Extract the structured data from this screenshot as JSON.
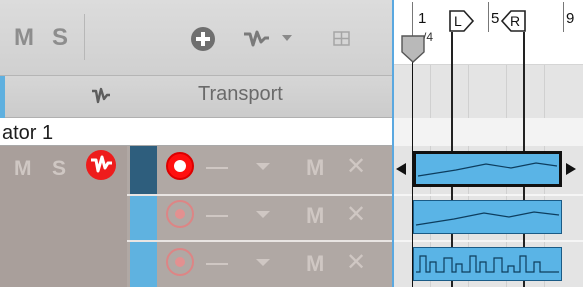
{
  "toolbar": {
    "mute_label": "M",
    "solo_label": "S",
    "add_icon": "plus-circle-icon",
    "automation_icon": "automation-wave-icon",
    "grid_icon": "grid-icon"
  },
  "header": {
    "wave_icon": "automation-wave-icon",
    "transport_label": "Transport"
  },
  "device": {
    "name": "ator 1",
    "mute_label": "M",
    "solo_label": "S",
    "automation_badge_icon": "automation-badge-icon"
  },
  "tracks": [
    {
      "record_active": true,
      "mute_label": "M"
    },
    {
      "record_active": false,
      "mute_label": "M"
    },
    {
      "record_active": false,
      "mute_label": "M"
    }
  ],
  "ruler": {
    "bar_1": "1",
    "beat_label": "/4",
    "bar_5": "5",
    "bar_9": "9",
    "left_locator": "L",
    "right_locator": "R"
  },
  "colors": {
    "accent_blue": "#5ab4e6",
    "record_red": "#ff1010",
    "track_bg": "#b0a8a4"
  }
}
